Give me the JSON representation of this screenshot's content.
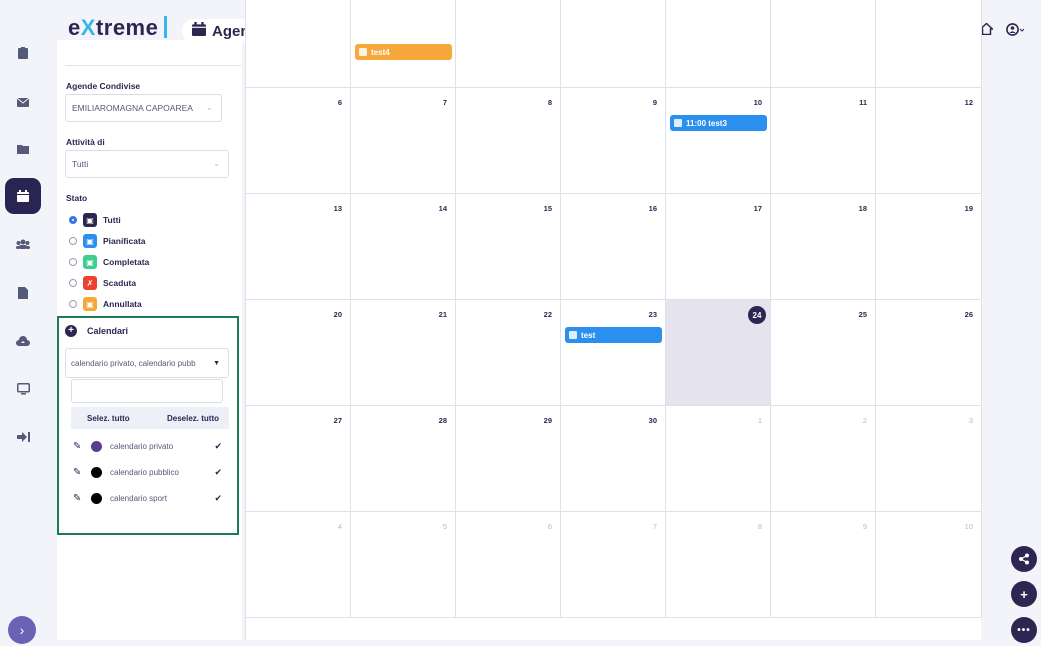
{
  "header": {
    "logo": {
      "pre": "e",
      "x": "X",
      "post": "treme"
    },
    "page_title": "Agenda",
    "icons": [
      "bell-icon",
      "fullscreen-icon",
      "settings-icon",
      "home-icon",
      "user-icon"
    ]
  },
  "rail": {
    "items": [
      {
        "name": "clipboard-icon",
        "active": false
      },
      {
        "name": "mail-icon",
        "active": false
      },
      {
        "name": "folder-icon",
        "active": false
      },
      {
        "name": "calendar-icon",
        "active": true
      },
      {
        "name": "users-icon",
        "active": false
      },
      {
        "name": "document-icon",
        "active": false
      },
      {
        "name": "cloud-upload-icon",
        "active": false
      },
      {
        "name": "monitor-icon",
        "active": false
      },
      {
        "name": "logout-icon",
        "active": false
      }
    ]
  },
  "sidebar": {
    "agende_label": "Agende Condivise",
    "agende_value": "EMILIAROMAGNA CAPOAREA",
    "attivita_label": "Attività di",
    "attivita_value": "Tutti",
    "stato_label": "Stato",
    "stati": [
      {
        "label": "Tutti",
        "color": "#2d2650",
        "selected": true
      },
      {
        "label": "Pianificata",
        "color": "#2b8ff0",
        "selected": false
      },
      {
        "label": "Completata",
        "color": "#3dcf8e",
        "selected": false
      },
      {
        "label": "Scaduta",
        "color": "#f0402f",
        "selected": false
      },
      {
        "label": "Annullata",
        "color": "#f6a93a",
        "selected": false
      }
    ]
  },
  "calendari": {
    "title": "Calendari",
    "selected_text": "calendario privato, calendario pubb",
    "filter_placeholder": "",
    "select_all": "Selez. tutto",
    "deselect_all": "Deselez. tutto",
    "items": [
      {
        "label": "calendario privato",
        "color": "#5b3f8f"
      },
      {
        "label": "calendario pubblico",
        "color": "#000000"
      },
      {
        "label": "calendario sport",
        "color": "#000000"
      }
    ]
  },
  "calendar": {
    "weeks": [
      [
        {
          "d": "",
          "dim": false
        },
        {
          "d": "",
          "dim": false
        },
        {
          "d": "",
          "dim": false
        },
        {
          "d": "",
          "dim": false
        },
        {
          "d": "",
          "dim": false
        },
        {
          "d": "",
          "dim": false
        },
        {
          "d": "",
          "dim": false
        }
      ],
      [
        {
          "d": "6"
        },
        {
          "d": "7"
        },
        {
          "d": "8"
        },
        {
          "d": "9"
        },
        {
          "d": "10"
        },
        {
          "d": "11"
        },
        {
          "d": "12"
        }
      ],
      [
        {
          "d": "13"
        },
        {
          "d": "14"
        },
        {
          "d": "15"
        },
        {
          "d": "16"
        },
        {
          "d": "17"
        },
        {
          "d": "18"
        },
        {
          "d": "19"
        }
      ],
      [
        {
          "d": "20"
        },
        {
          "d": "21"
        },
        {
          "d": "22"
        },
        {
          "d": "23"
        },
        {
          "d": "24",
          "today": true
        },
        {
          "d": "25"
        },
        {
          "d": "26"
        }
      ],
      [
        {
          "d": "27"
        },
        {
          "d": "28"
        },
        {
          "d": "29"
        },
        {
          "d": "30"
        },
        {
          "d": "1",
          "dim": true
        },
        {
          "d": "2",
          "dim": true
        },
        {
          "d": "3",
          "dim": true
        }
      ],
      [
        {
          "d": "4",
          "dim": true
        },
        {
          "d": "5",
          "dim": true
        },
        {
          "d": "6",
          "dim": true
        },
        {
          "d": "7",
          "dim": true
        },
        {
          "d": "8",
          "dim": true
        },
        {
          "d": "9",
          "dim": true
        },
        {
          "d": "10",
          "dim": true
        }
      ]
    ],
    "events": [
      {
        "week": 0,
        "day": 1,
        "label": "test4",
        "color": "orange"
      },
      {
        "week": 1,
        "day": 4,
        "label": "11:00 test3",
        "color": "blue"
      },
      {
        "week": 3,
        "day": 3,
        "label": "test",
        "color": "blue"
      }
    ]
  },
  "fabs": [
    "share-icon",
    "plus-icon",
    "more-icon"
  ]
}
